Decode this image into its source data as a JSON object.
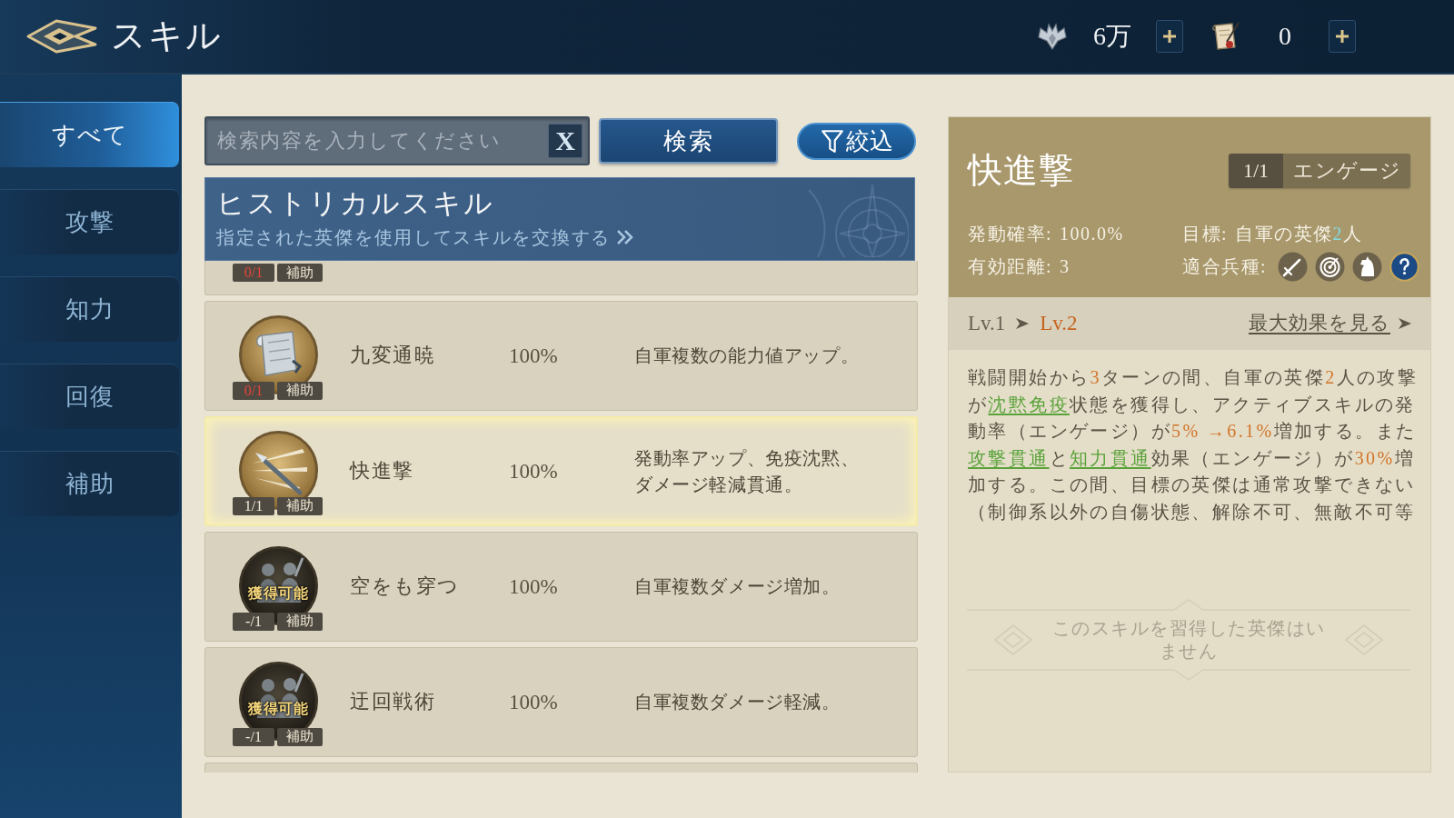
{
  "header": {
    "title": "スキル",
    "currencies": [
      {
        "kind": "crest",
        "amount": "6万"
      },
      {
        "kind": "scroll",
        "amount": "0"
      }
    ]
  },
  "sidebar": {
    "items": [
      {
        "label": "すべて",
        "selected": true
      },
      {
        "label": "攻撃",
        "selected": false
      },
      {
        "label": "知力",
        "selected": false
      },
      {
        "label": "回復",
        "selected": false
      },
      {
        "label": "補助",
        "selected": false
      }
    ]
  },
  "search": {
    "placeholder": "検索内容を入力してください",
    "clear_label": "X",
    "button": "検索",
    "filter": "絞込"
  },
  "banner": {
    "title": "ヒストリカルスキル",
    "link": "指定された英傑を使用してスキルを交換する"
  },
  "list": {
    "clipped_row": {
      "count": {
        "text": "0/1",
        "insufficient": true
      },
      "tag": "補助"
    },
    "rows": [
      {
        "kind": "scroll",
        "name": "九変通暁",
        "rate": "100%",
        "effect": "自軍複数の能力値アップ。",
        "count": {
          "text": "0/1",
          "insufficient": true
        },
        "tag": "補助",
        "selected": false
      },
      {
        "kind": "spear",
        "name": "快進撃",
        "rate": "100%",
        "effect": "発動率アップ、免疫沈黙、ダメージ軽減貫通。",
        "count": {
          "text": "1/1",
          "insufficient": false
        },
        "tag": "補助",
        "selected": true
      },
      {
        "kind": "soldiers",
        "name": "空をも穿つ",
        "rate": "100%",
        "effect": "自軍複数ダメージ増加。",
        "status": "獲得可能",
        "count": {
          "text": "-/1",
          "insufficient": false
        },
        "tag": "補助",
        "selected": false
      },
      {
        "kind": "soldiers",
        "name": "迂回戦術",
        "rate": "100%",
        "effect": "自軍複数ダメージ軽減。",
        "status": "獲得可能",
        "count": {
          "text": "-/1",
          "insufficient": false
        },
        "tag": "補助",
        "selected": false
      }
    ]
  },
  "detail": {
    "title": "快進撃",
    "count": "1/1",
    "type": "エンゲージ",
    "stats": [
      {
        "label": "発動確率:",
        "value": [
          {
            "kind": "plain",
            "text": "100.0%"
          }
        ]
      },
      {
        "label": "目標:",
        "value": [
          {
            "kind": "plain",
            "text": "自軍の英傑"
          },
          {
            "kind": "highlight",
            "text": "2"
          },
          {
            "kind": "plain",
            "text": "人"
          }
        ]
      },
      {
        "label": "有効距離:",
        "value": [
          {
            "kind": "plain",
            "text": "3"
          }
        ]
      }
    ],
    "troops_label": "適合兵種:",
    "level_from": "Lv.1",
    "level_to": "Lv.2",
    "max_effect_link": "最大効果を見る",
    "description": [
      {
        "kind": "plain",
        "text": "戦闘開始から"
      },
      {
        "kind": "number",
        "text": "3"
      },
      {
        "kind": "plain",
        "text": "ターンの間、自軍の英傑"
      },
      {
        "kind": "number",
        "text": "2"
      },
      {
        "kind": "plain",
        "text": "人の攻撃が"
      },
      {
        "kind": "link",
        "text": "沈黙免疫"
      },
      {
        "kind": "plain",
        "text": "状態を獲得し、アクティブスキルの発動率（エンゲージ）が"
      },
      {
        "kind": "number",
        "text": "5% →6.1%"
      },
      {
        "kind": "plain",
        "text": "増加する。また"
      },
      {
        "kind": "link",
        "text": "攻撃貫通"
      },
      {
        "kind": "plain",
        "text": "と"
      },
      {
        "kind": "link",
        "text": "知力貫通"
      },
      {
        "kind": "plain",
        "text": "効果（エンゲージ）が"
      },
      {
        "kind": "number",
        "text": "30%"
      },
      {
        "kind": "plain",
        "text": "増加する。この間、目標の英傑は通常攻撃できない（制御系以外の自傷状態、解除不可、無敵不可等"
      }
    ],
    "empty_note": "このスキルを習得した英傑はいません"
  }
}
